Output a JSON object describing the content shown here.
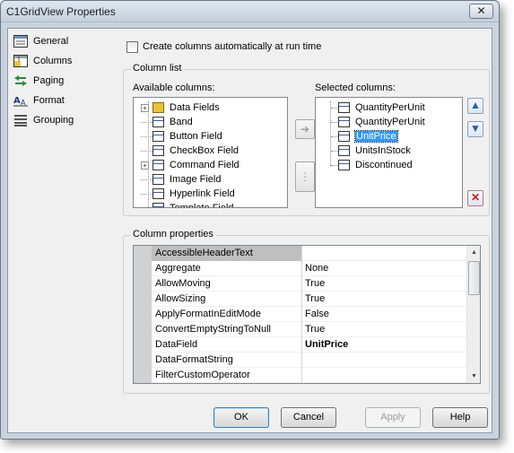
{
  "window": {
    "title": "C1GridView Properties",
    "close_glyph": "✕"
  },
  "nav": {
    "items": [
      {
        "label": "General",
        "icon": "general-icon"
      },
      {
        "label": "Columns",
        "icon": "columns-icon"
      },
      {
        "label": "Paging",
        "icon": "paging-icon"
      },
      {
        "label": "Format",
        "icon": "format-icon"
      },
      {
        "label": "Grouping",
        "icon": "grouping-icon"
      }
    ]
  },
  "auto_columns": {
    "label": "Create columns automatically at run time",
    "checked": false
  },
  "column_list": {
    "group_label": "Column list",
    "available_label": "Available columns:",
    "selected_label": "Selected columns:",
    "available": [
      {
        "label": "Data Fields",
        "expandable": true,
        "icon": "data-fields-icon"
      },
      {
        "label": "Band",
        "expandable": false,
        "icon": "band-icon"
      },
      {
        "label": "Button Field",
        "expandable": false,
        "icon": "button-field-icon"
      },
      {
        "label": "CheckBox Field",
        "expandable": false,
        "icon": "checkbox-field-icon"
      },
      {
        "label": "Command Field",
        "expandable": true,
        "icon": "command-field-icon"
      },
      {
        "label": "Image Field",
        "expandable": false,
        "icon": "image-field-icon"
      },
      {
        "label": "Hyperlink Field",
        "expandable": false,
        "icon": "hyperlink-field-icon"
      },
      {
        "label": "Template Field",
        "expandable": false,
        "icon": "template-field-icon"
      }
    ],
    "selected": [
      {
        "label": "QuantityPerUnit",
        "highlighted": false
      },
      {
        "label": "QuantityPerUnit",
        "highlighted": false
      },
      {
        "label": "UnitPrice",
        "highlighted": true
      },
      {
        "label": "UnitsInStock",
        "highlighted": false
      },
      {
        "label": "Discontinued",
        "highlighted": false
      }
    ],
    "add_glyph": "➔",
    "band_glyph": "⋮",
    "up_glyph": "▲",
    "down_glyph": "▼",
    "delete_glyph": "✕"
  },
  "column_properties": {
    "group_label": "Column properties",
    "rows": [
      {
        "name": "AccessibleHeaderText",
        "value": "",
        "selected": true,
        "bold": false
      },
      {
        "name": "Aggregate",
        "value": "None",
        "selected": false,
        "bold": false
      },
      {
        "name": "AllowMoving",
        "value": "True",
        "selected": false,
        "bold": false
      },
      {
        "name": "AllowSizing",
        "value": "True",
        "selected": false,
        "bold": false
      },
      {
        "name": "ApplyFormatInEditMode",
        "value": "False",
        "selected": false,
        "bold": false
      },
      {
        "name": "ConvertEmptyStringToNull",
        "value": "True",
        "selected": false,
        "bold": false
      },
      {
        "name": "DataField",
        "value": "UnitPrice",
        "selected": false,
        "bold": true
      },
      {
        "name": "DataFormatString",
        "value": "",
        "selected": false,
        "bold": false
      },
      {
        "name": "FilterCustomOperator",
        "value": "",
        "selected": false,
        "bold": false
      }
    ]
  },
  "buttons": {
    "ok": "OK",
    "cancel": "Cancel",
    "apply": "Apply",
    "help": "Help"
  },
  "colors": {
    "selection": "#3399ff",
    "selected_row": "#bfbfbf",
    "delete_red": "#d11a1a"
  }
}
